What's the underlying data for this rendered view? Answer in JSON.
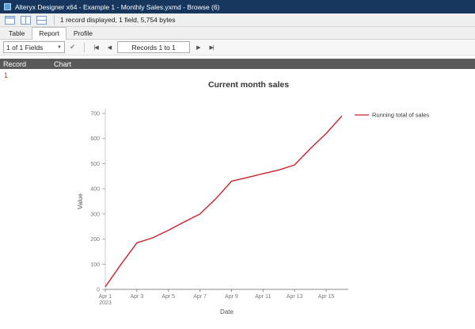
{
  "titlebar": {
    "title": "Alteryx Designer x64 - Example 1 - Monthly Sales.yxmd - Browse (6)"
  },
  "toolbar": {
    "status": "1 record displayed, 1 field, 5,754 bytes"
  },
  "tabs": [
    {
      "label": "Table"
    },
    {
      "label": "Report"
    },
    {
      "label": "Profile"
    }
  ],
  "nav": {
    "fields_selector": "1 of 1 Fields",
    "records_label": "Records 1 to 1"
  },
  "icons": {
    "dropdown_arrow": "▼",
    "checkmark": "✔",
    "nav_first": "|◀",
    "nav_prev": "◀",
    "nav_next": "▶",
    "nav_last": "▶|"
  },
  "grid": {
    "columns": [
      "Record",
      "Chart"
    ],
    "record_value": "1"
  },
  "chart_data": {
    "type": "line",
    "title": "Current month sales",
    "xlabel": "Date",
    "ylabel": "Value",
    "line_color": "#cc2229",
    "legend": [
      {
        "name": "Running total of sales",
        "color": "#cc2229"
      }
    ],
    "legend_position": "top-right",
    "grid": false,
    "ylim": [
      0,
      700
    ],
    "y_ticks": [
      0,
      100,
      200,
      300,
      400,
      500,
      600,
      700
    ],
    "x": [
      "Apr 1",
      "Apr 2",
      "Apr 3",
      "Apr 4",
      "Apr 5",
      "Apr 6",
      "Apr 7",
      "Apr 8",
      "Apr 9",
      "Apr 10",
      "Apr 11",
      "Apr 12",
      "Apr 13",
      "Apr 14",
      "Apr 15",
      "Apr 16"
    ],
    "x_ticks": [
      {
        "index": 0,
        "label": "Apr 1",
        "sub": "2023"
      },
      {
        "index": 2,
        "label": "Apr 3"
      },
      {
        "index": 4,
        "label": "Apr 5"
      },
      {
        "index": 6,
        "label": "Apr 7"
      },
      {
        "index": 8,
        "label": "Apr 9"
      },
      {
        "index": 10,
        "label": "Apr 11"
      },
      {
        "index": 12,
        "label": "Apr 13"
      },
      {
        "index": 14,
        "label": "Apr 15"
      }
    ],
    "series": [
      {
        "name": "Running total of sales",
        "values": [
          10,
          100,
          185,
          205,
          235,
          268,
          300,
          360,
          430,
          445,
          460,
          475,
          495,
          560,
          620,
          690
        ]
      }
    ]
  }
}
